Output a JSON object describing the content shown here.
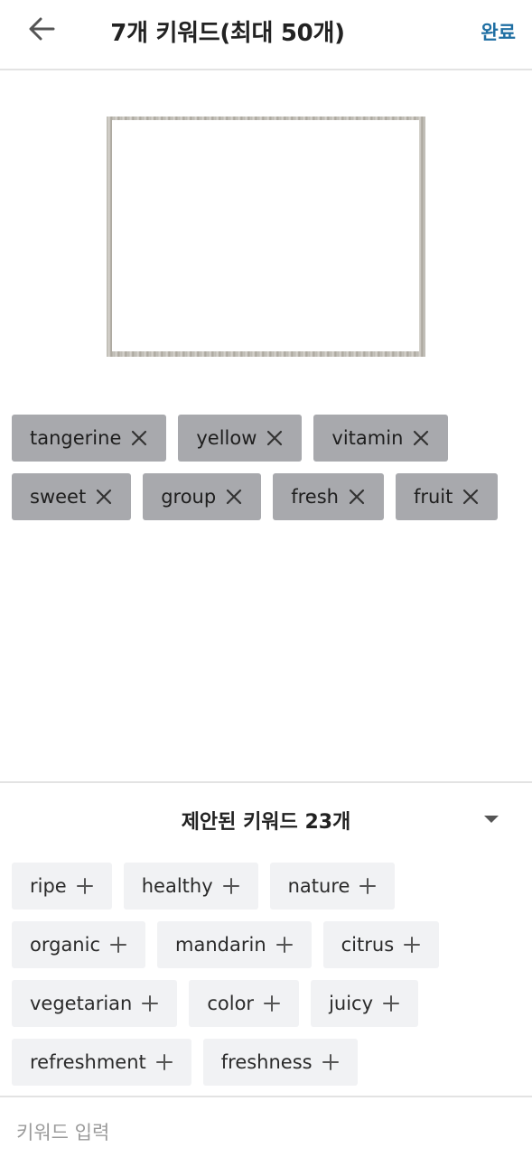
{
  "header": {
    "back_icon": "arrow-left-icon",
    "title": "7개 키워드(최대 50개)",
    "done_label": "완료",
    "done_color": "#1f6fa3"
  },
  "selected_keywords": [
    [
      "tangerine",
      "yellow",
      "vitamin"
    ],
    [
      "sweet",
      "group",
      "fresh",
      "fruit"
    ]
  ],
  "remove_icon": "close-icon",
  "suggestions": {
    "title": "제안된 키워드 23개",
    "collapse_icon": "caret-down-icon",
    "add_icon": "plus-icon",
    "rows": [
      [
        "ripe",
        "healthy",
        "nature"
      ],
      [
        "organic",
        "mandarin",
        "citrus"
      ],
      [
        "vegetarian",
        "color",
        "juicy"
      ],
      [
        "refreshment",
        "freshness"
      ]
    ]
  },
  "input": {
    "placeholder": "키워드 입력"
  },
  "colors": {
    "selected_tag_bg": "#a8a9ad",
    "suggestion_chip_bg": "#f1f2f4"
  }
}
